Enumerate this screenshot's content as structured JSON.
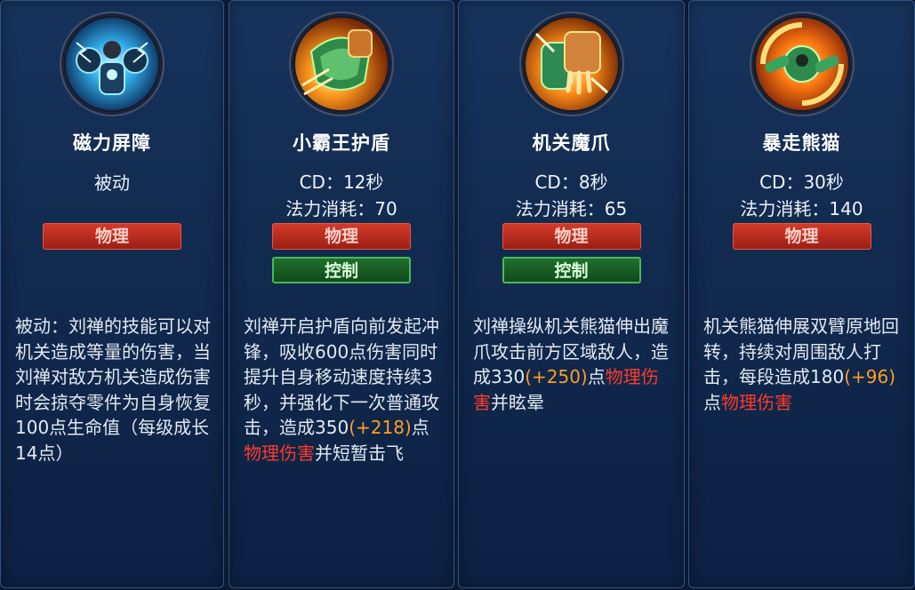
{
  "skills": [
    {
      "name": "磁力屏障",
      "icon": "magnetic-barrier-skill-icon",
      "passive_label": "被动",
      "tags": [
        "物理"
      ],
      "description": [
        {
          "text": "被动：刘禅的技能可以对机关造成等量的伤害，当刘禅对敌方机关造成伤害时会掠夺零件为自身恢复100点生命值（每级成长14点）",
          "style": "normal"
        }
      ]
    },
    {
      "name": "小霸王护盾",
      "icon": "little-overlord-shield-skill-icon",
      "cd": "CD：12秒",
      "mana": "法力消耗：70",
      "tags": [
        "物理",
        "控制"
      ],
      "description": [
        {
          "text": "刘禅开启护盾向前发起冲锋，吸收600点伤害同时提升自身移动速度持续3秒，并强化下一次普通攻击，造成350",
          "style": "normal"
        },
        {
          "text": "(+218)",
          "style": "orange"
        },
        {
          "text": "点",
          "style": "normal"
        },
        {
          "text": "物理伤害",
          "style": "red"
        },
        {
          "text": "并短暂击飞",
          "style": "normal"
        }
      ]
    },
    {
      "name": "机关魔爪",
      "icon": "mech-claw-skill-icon",
      "cd": "CD：8秒",
      "mana": "法力消耗：65",
      "tags": [
        "物理",
        "控制"
      ],
      "description": [
        {
          "text": "刘禅操纵机关熊猫伸出魔爪攻击前方区域敌人，造成330",
          "style": "normal"
        },
        {
          "text": "(+250)",
          "style": "orange"
        },
        {
          "text": "点",
          "style": "normal"
        },
        {
          "text": "物理伤害",
          "style": "red"
        },
        {
          "text": "并眩晕",
          "style": "normal"
        }
      ]
    },
    {
      "name": "暴走熊猫",
      "icon": "rampaging-panda-skill-icon",
      "cd": "CD：30秒",
      "mana": "法力消耗：140",
      "tags": [
        "物理"
      ],
      "description": [
        {
          "text": "机关熊猫伸展双臂原地回转，持续对周围敌人打击，每段造成180",
          "style": "normal"
        },
        {
          "text": "(+96)",
          "style": "orange"
        },
        {
          "text": "点",
          "style": "normal"
        },
        {
          "text": "物理伤害",
          "style": "red"
        }
      ]
    }
  ],
  "colors": {
    "bonus": "#ff9d27",
    "physical_damage": "#ff3a2a",
    "physical_badge": "#c0301f",
    "control_badge": "#1f6f2c"
  }
}
